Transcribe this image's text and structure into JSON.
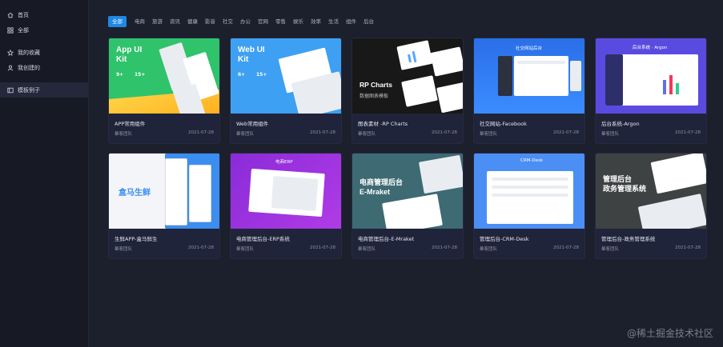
{
  "sidebar": {
    "items": [
      {
        "label": "首页",
        "icon": "home-icon"
      },
      {
        "label": "全部",
        "icon": "grid-icon"
      },
      {
        "label": "我的收藏",
        "icon": "star-icon"
      },
      {
        "label": "我创建的",
        "icon": "user-icon"
      },
      {
        "label": "模板例子",
        "icon": "template-icon",
        "active": true
      }
    ]
  },
  "tabs": [
    "全部",
    "电商",
    "旅游",
    "资讯",
    "健康",
    "影音",
    "社交",
    "办公",
    "官网",
    "零售",
    "娱乐",
    "效率",
    "生活",
    "组件",
    "后台"
  ],
  "active_tab": "全部",
  "cards": [
    {
      "title": "APP常用组件",
      "team": "摹客团队",
      "date": "2021-07-28",
      "thumb_text": [
        "App UI",
        "Kit"
      ],
      "thumb_badges": [
        "9+",
        "15+"
      ]
    },
    {
      "title": "Web常用组件",
      "team": "摹客团队",
      "date": "2021-07-28",
      "thumb_text": [
        "Web UI",
        "Kit"
      ],
      "thumb_badges": [
        "6+",
        "15+"
      ]
    },
    {
      "title": "图表素材 -RP Charts",
      "team": "摹客团队",
      "date": "2021-07-28",
      "thumb_text": [
        "RP Charts"
      ],
      "thumb_sub": "数据图表模板"
    },
    {
      "title": "社交网站-Facebook",
      "team": "摹客团队",
      "date": "2021-07-28",
      "thumb_sub": "社交网站后台"
    },
    {
      "title": "后台系统-Argon",
      "team": "摹客团队",
      "date": "2021-07-28",
      "thumb_sub": "后台系统 · Argon"
    },
    {
      "title": "生鲜APP-盒马鲜生",
      "team": "摹客团队",
      "date": "2021-07-28",
      "thumb_text": [
        "盒马生鲜"
      ]
    },
    {
      "title": "电商管理后台-ERP系统",
      "team": "摹客团队",
      "date": "2021-07-28",
      "thumb_sub": "电商ERP"
    },
    {
      "title": "电商管理后台-E-Mraket",
      "team": "摹客团队",
      "date": "2021-07-28",
      "thumb_text": [
        "电商管理后台",
        "E-Mraket"
      ]
    },
    {
      "title": "管理后台-CRM-Desk",
      "team": "摹客团队",
      "date": "2021-07-28",
      "thumb_sub": "CRM-Desk"
    },
    {
      "title": "管理后台-政务管理系统",
      "team": "摹客团队",
      "date": "2021-07-28",
      "thumb_text": [
        "管理后台",
        "政务管理系统"
      ]
    }
  ],
  "watermark": "@稀土掘金技术社区",
  "colors": {
    "accent": "#1e88e5",
    "background": "#1c1f2c",
    "sidebar": "#171a25",
    "card": "#20243a"
  }
}
